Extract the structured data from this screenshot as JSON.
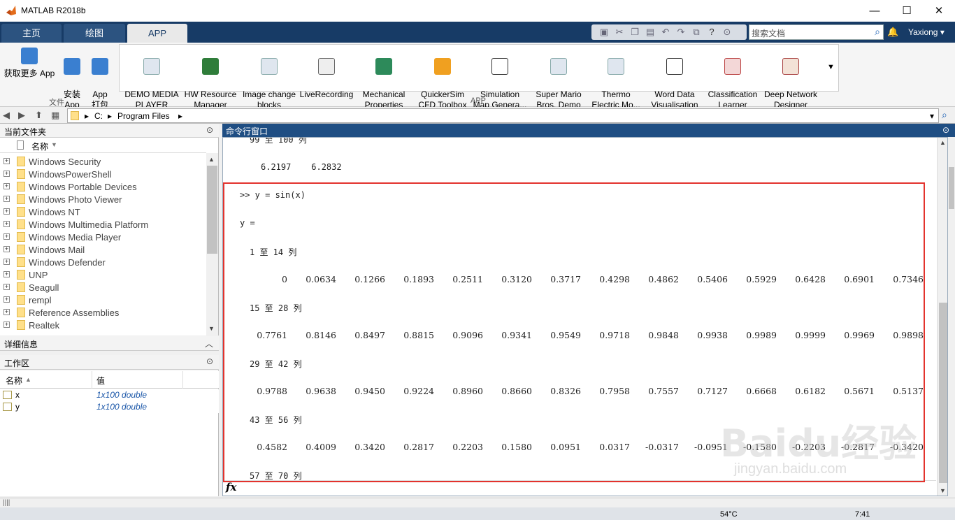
{
  "window": {
    "title": "MATLAB R2018b",
    "min": "—",
    "max": "☐",
    "close": "✕"
  },
  "tabs": [
    {
      "label": "主页"
    },
    {
      "label": "绘图"
    },
    {
      "label": "APP"
    }
  ],
  "search": {
    "placeholder": "搜索文档"
  },
  "user": "Yaxiong",
  "ribbon": {
    "file_group": [
      {
        "label": "获取更多 App"
      },
      {
        "label": "安装\nApp"
      },
      {
        "label": "App\n打包"
      }
    ],
    "file_group_label": "文件",
    "app_group_label": "APP",
    "apps": [
      {
        "label": "DEMO MEDIA\nPLAYER"
      },
      {
        "label": "HW Resource\nManager"
      },
      {
        "label": "Image change\nblocks"
      },
      {
        "label": "LiveRecording"
      },
      {
        "label": "Mechanical\nProperties"
      },
      {
        "label": "QuickerSim\nCFD Toolbox"
      },
      {
        "label": "Simulation\nMap Genera..."
      },
      {
        "label": "Super Mario\nBros. Demo"
      },
      {
        "label": "Thermo\nElectric Mo..."
      },
      {
        "label": "Word Data\nVisualisation"
      },
      {
        "label": "Classification\nLearner"
      },
      {
        "label": "Deep Network\nDesigner"
      }
    ]
  },
  "path": {
    "drive": "C:",
    "folder": "Program Files"
  },
  "current_folder": {
    "title": "当前文件夹",
    "column": "名称",
    "items": [
      "Windows Security",
      "WindowsPowerShell",
      "Windows Portable Devices",
      "Windows Photo Viewer",
      "Windows NT",
      "Windows Multimedia Platform",
      "Windows Media Player",
      "Windows Mail",
      "Windows Defender",
      "UNP",
      "Seagull",
      "rempl",
      "Reference Assemblies",
      "Realtek"
    ]
  },
  "details": {
    "title": "详细信息"
  },
  "workspace": {
    "title": "工作区",
    "col_name": "名称",
    "col_value": "值",
    "vars": [
      {
        "name": "x",
        "value": "1x100 double"
      },
      {
        "name": "y",
        "value": "1x100 double"
      }
    ]
  },
  "command_window": {
    "title": "命令行窗口",
    "top_header": "99 至 100 列",
    "top_values": "6.2197    6.2832",
    "command": ">> y = sin(x)",
    "var_echo": "y =",
    "blocks": [
      {
        "header": "1 至 14 列",
        "values": [
          "0",
          "0.0634",
          "0.1266",
          "0.1893",
          "0.2511",
          "0.3120",
          "0.3717",
          "0.4298",
          "0.4862",
          "0.5406",
          "0.5929",
          "0.6428",
          "0.6901",
          "0.7346"
        ]
      },
      {
        "header": "15 至 28 列",
        "values": [
          "0.7761",
          "0.8146",
          "0.8497",
          "0.8815",
          "0.9096",
          "0.9341",
          "0.9549",
          "0.9718",
          "0.9848",
          "0.9938",
          "0.9989",
          "0.9999",
          "0.9969",
          "0.9898"
        ]
      },
      {
        "header": "29 至 42 列",
        "values": [
          "0.9788",
          "0.9638",
          "0.9450",
          "0.9224",
          "0.8960",
          "0.8660",
          "0.8326",
          "0.7958",
          "0.7557",
          "0.7127",
          "0.6668",
          "0.6182",
          "0.5671",
          "0.5137"
        ]
      },
      {
        "header": "43 至 56 列",
        "values": [
          "0.4582",
          "0.4009",
          "0.3420",
          "0.2817",
          "0.2203",
          "0.1580",
          "0.0951",
          "0.0317",
          "-0.0317",
          "-0.0951",
          "-0.1580",
          "-0.2203",
          "-0.2817",
          "-0.3420"
        ]
      },
      {
        "header": "57 至 70 列",
        "values": []
      }
    ],
    "fx": "fx"
  },
  "watermark": {
    "main": "Baidu经验",
    "sub": "jingyan.baidu.com"
  },
  "taskbar": {
    "temp": "54°C",
    "time": "7:41"
  },
  "colors": {
    "tab_bar": "#173b66",
    "cmd_header": "#1f4e83",
    "highlight_box": "#e3332d"
  }
}
